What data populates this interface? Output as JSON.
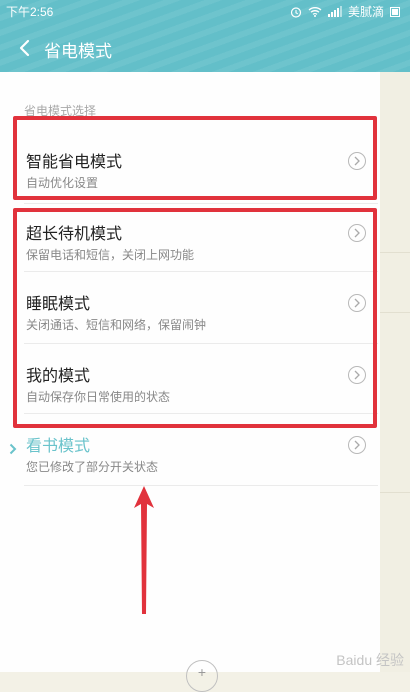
{
  "status_bar": {
    "time": "下午2:56",
    "carrier": "美腻滴"
  },
  "header": {
    "title": "省电模式"
  },
  "section": {
    "label": "省电模式选择"
  },
  "modes": [
    {
      "title": "智能省电模式",
      "desc": "自动优化设置"
    },
    {
      "title": "超长待机模式",
      "desc": "保留电话和短信，关闭上网功能"
    },
    {
      "title": "睡眠模式",
      "desc": "关闭通话、短信和网络，保留闹钟"
    },
    {
      "title": "我的模式",
      "desc": "自动保存你日常使用的状态"
    },
    {
      "title": "看书模式",
      "desc": "您已修改了部分开关状态"
    }
  ],
  "watermark": "Baidu 经验",
  "colors": {
    "accent": "#63bfc9",
    "highlight": "#e1323c",
    "selected": "#6ac3cb"
  },
  "icons": [
    "back-icon",
    "alarm-icon",
    "wifi-icon",
    "signal-icon",
    "battery-icon",
    "chevron-right-icon",
    "selected-indicator-icon",
    "add-icon"
  ]
}
